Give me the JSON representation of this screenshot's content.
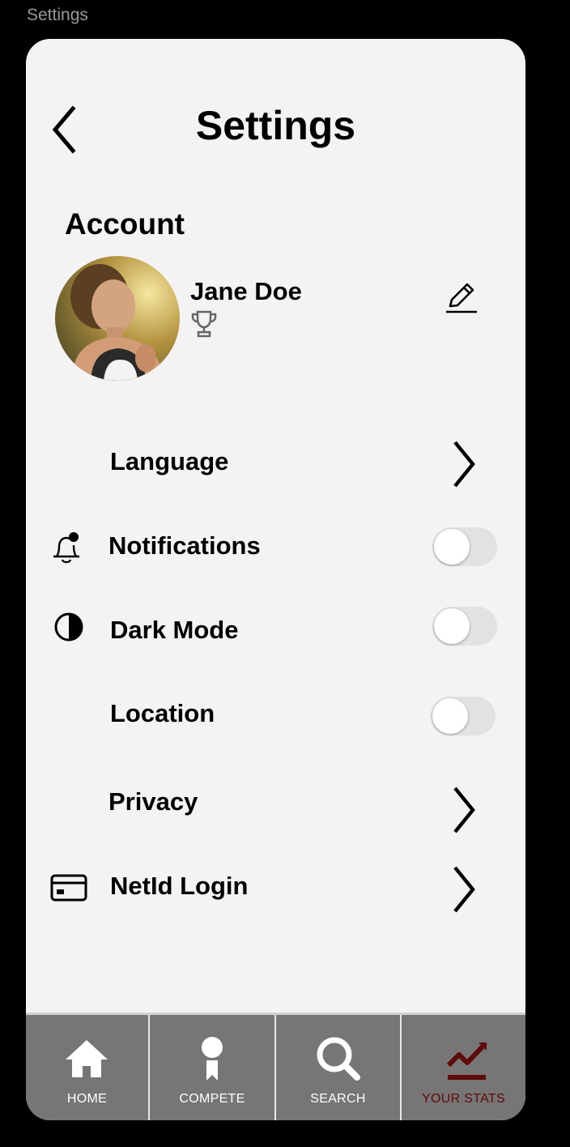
{
  "window": {
    "label": "Settings"
  },
  "header": {
    "title": "Settings"
  },
  "account": {
    "section_title": "Account",
    "user_name": "Jane Doe"
  },
  "settings": {
    "language_label": "Language",
    "notifications_label": "Notifications",
    "notifications_on": false,
    "dark_mode_label": "Dark Mode",
    "dark_mode_on": false,
    "location_label": "Location",
    "location_on": false,
    "privacy_label": "Privacy",
    "netid_label": "NetId Login"
  },
  "icons": {
    "back": "chevron-left-icon",
    "edit": "pencil-icon",
    "trophy": "trophy-icon",
    "notifications": "bell-icon",
    "dark_mode": "half-circle-icon",
    "netid": "credit-card-icon"
  },
  "nav": {
    "items": [
      {
        "label": "HOME",
        "icon": "home-icon",
        "active": false
      },
      {
        "label": "COMPETE",
        "icon": "award-ribbon-icon",
        "active": false
      },
      {
        "label": "SEARCH",
        "icon": "search-icon",
        "active": false
      },
      {
        "label": "YOUR STATS",
        "icon": "trending-chart-icon",
        "active": true
      }
    ]
  },
  "colors": {
    "screen_bg": "#f4f2f3",
    "nav_bg": "#777576",
    "active_nav": "#5e0b0b",
    "toggle_off": "#e3e1e2"
  }
}
